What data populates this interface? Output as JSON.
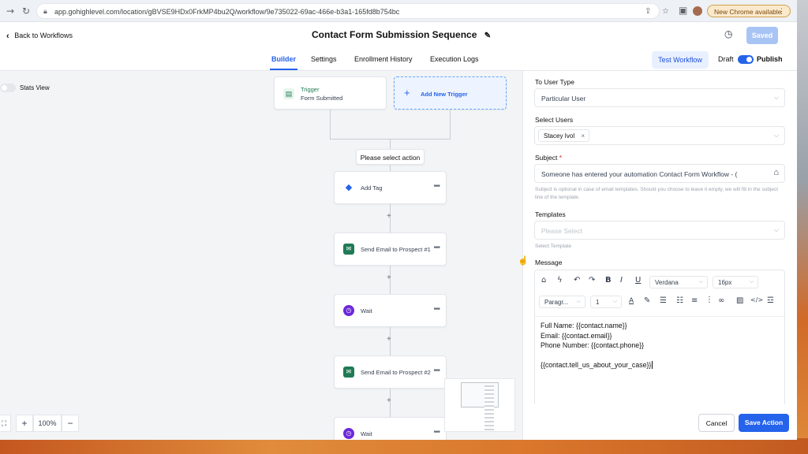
{
  "browser": {
    "url": "app.gohighlevel.com/location/gBVSE9HDx0FrkMP4bu2Q/workflow/9e735022-69ac-466e-b3a1-165fd8b754bc",
    "new_chrome_label": "New Chrome available"
  },
  "header": {
    "back_label": "Back to Workflows",
    "title": "Contact Form Submission Sequence",
    "saved_label": "Saved"
  },
  "tabs": [
    {
      "label": "Builder",
      "active": true
    },
    {
      "label": "Settings"
    },
    {
      "label": "Enrollment History"
    },
    {
      "label": "Execution Logs"
    }
  ],
  "toolbar": {
    "test_workflow_label": "Test Workflow",
    "draft_label": "Draft",
    "publish_label": "Publish"
  },
  "canvas": {
    "stats_view_label": "Stats View",
    "trigger": {
      "title": "Trigger",
      "subtitle": "Form Submitted"
    },
    "add_trigger_label": "Add New Trigger",
    "select_action_label": "Please select action",
    "nodes": [
      {
        "label": "Add Tag",
        "icon": "tag-icon",
        "color": "#2563eb"
      },
      {
        "label": "Send Email to Prospect #1",
        "icon": "email-icon",
        "color": "#1f7a55"
      },
      {
        "label": "Wait",
        "icon": "clock-icon",
        "color": "#6d28d9"
      },
      {
        "label": "Send Email to Prospect #2",
        "icon": "email-icon",
        "color": "#1f7a55"
      },
      {
        "label": "Wait",
        "icon": "clock-icon",
        "color": "#6d28d9"
      }
    ],
    "zoom_level": "100%"
  },
  "panel": {
    "user_type_label": "To User Type",
    "user_type_value": "Particular User",
    "select_users_label": "Select Users",
    "selected_user": "Stacey Ivol",
    "subject_label": "Subject",
    "subject_required": "*",
    "subject_value": "Someone has entered your automation Contact Form Workflow - (",
    "subject_hint": "Subject is optional in case of email templates. Should you choose to leave it empty, we will fill in the subject line of the template.",
    "templates_label": "Templates",
    "templates_placeholder": "Please Select",
    "templates_hint": "Select Template",
    "message_label": "Message",
    "font_family": "Verdana",
    "font_size": "16px",
    "paragraph_select": "Paragr...",
    "line_height_select": "1",
    "message_lines": [
      "Full Name: {{contact.name}}",
      "Email: {{contact.email}}",
      "Phone Number: {{contact.phone}}",
      "",
      "{{contact.tell_us_about_your_case}}"
    ],
    "cancel_label": "Cancel",
    "save_label": "Save Action"
  },
  "colors": {
    "accent": "#2563eb",
    "saved_bg": "#a8c4f5"
  }
}
